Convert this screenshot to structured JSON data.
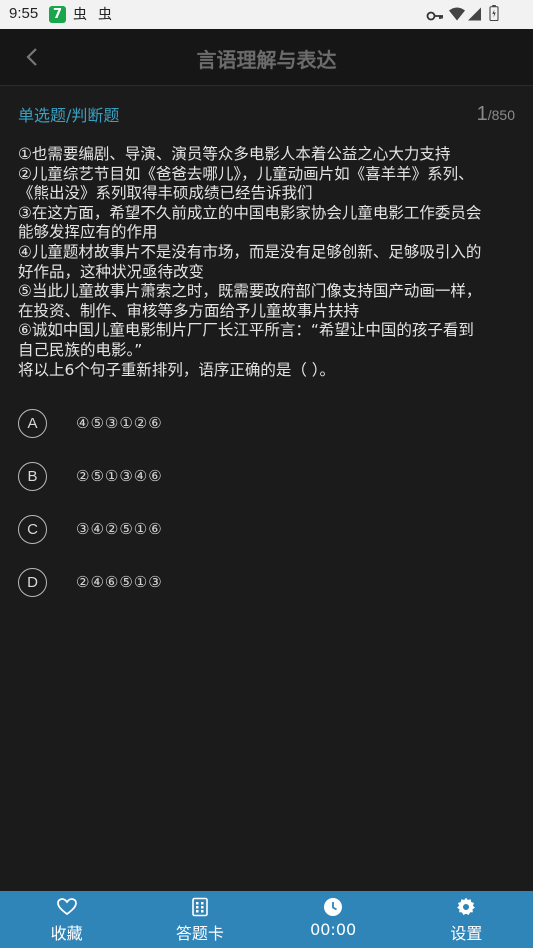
{
  "statusbar": {
    "time": "9:55",
    "badge": "7",
    "bug1": "虫",
    "bug2": "虫"
  },
  "header": {
    "title": "言语理解与表达"
  },
  "question": {
    "type": "单选题/判断题",
    "current": "1",
    "total": "/850",
    "lines": [
      "①也需要编剧、导演、演员等众多电影人本着公益之心大力支持",
      "②儿童综艺节目如《爸爸去哪儿》，儿童动画片如《喜羊羊》系列、",
      "《熊出没》系列取得丰硕成绩已经告诉我们",
      "③在这方面，希望不久前成立的中国电影家协会儿童电影工作委员会",
      "能够发挥应有的作用",
      "④儿童题材故事片不是没有市场，而是没有足够创新、足够吸引入的",
      "好作品，这种状况亟待改变",
      "⑤当此儿童故事片萧索之时，既需要政府部门像支持国产动画一样，",
      "在投资、制作、审核等多方面给予儿童故事片扶持",
      "⑥诚如中国儿童电影制片厂厂长江平所言：“希望让中国的孩子看到",
      "自己民族的电影。”",
      "将以上6个句子重新排列，语序正确的是（ ）。"
    ]
  },
  "options": [
    {
      "letter": "A",
      "text": "④⑤③①②⑥"
    },
    {
      "letter": "B",
      "text": "②⑤①③④⑥"
    },
    {
      "letter": "C",
      "text": "③④②⑤①⑥"
    },
    {
      "letter": "D",
      "text": "②④⑥⑤①③"
    }
  ],
  "bottom_nav": [
    {
      "label": "收藏",
      "icon": "heart-icon"
    },
    {
      "label": "答题卡",
      "icon": "answer-card-icon"
    },
    {
      "label": "00:00",
      "icon": "clock-icon"
    },
    {
      "label": "设置",
      "icon": "gear-icon"
    }
  ],
  "colors": {
    "accent": "#3aa0c0",
    "bottom_bar": "#2f84b8",
    "background": "#1b1b1b"
  }
}
